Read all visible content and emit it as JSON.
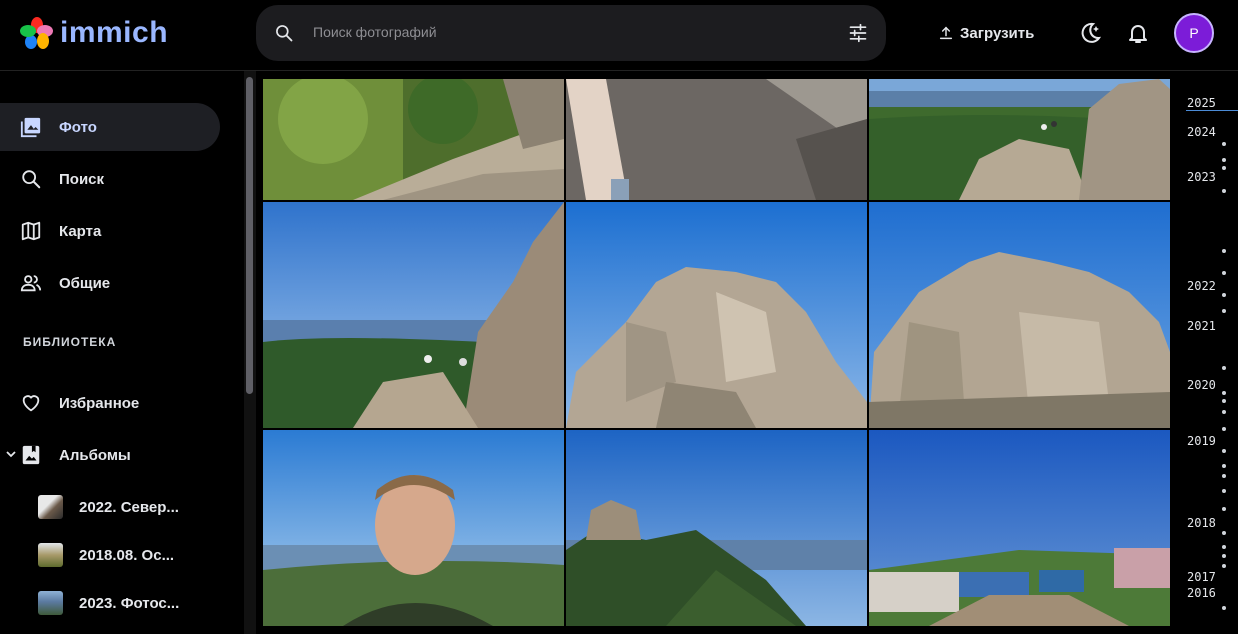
{
  "app": {
    "name": "immich"
  },
  "header": {
    "search_placeholder": "Поиск фотографий",
    "upload_label": "Загрузить",
    "avatar_initial": "P"
  },
  "sidebar": {
    "items": [
      {
        "label": "Фото",
        "icon": "photos-icon",
        "active": true
      },
      {
        "label": "Поиск",
        "icon": "search-icon",
        "active": false
      },
      {
        "label": "Карта",
        "icon": "map-icon",
        "active": false
      },
      {
        "label": "Общие",
        "icon": "people-icon",
        "active": false
      }
    ],
    "library_title": "БИБЛИОТЕКА",
    "library_items": [
      {
        "label": "Избранное",
        "icon": "heart-icon"
      },
      {
        "label": "Альбомы",
        "icon": "albums-icon"
      }
    ],
    "albums": [
      {
        "label": "2022. Север..."
      },
      {
        "label": "2018.08. Ос..."
      },
      {
        "label": "2023. Фотос..."
      }
    ]
  },
  "timeline": {
    "years": [
      "2025",
      "2024",
      "2023",
      "2022",
      "2021",
      "2020",
      "2019",
      "2018",
      "2017",
      "2016"
    ]
  },
  "colors": {
    "accent": "#9ab7ff",
    "avatar": "#7c1cd8",
    "active_nav_bg": "#1e1f24"
  }
}
